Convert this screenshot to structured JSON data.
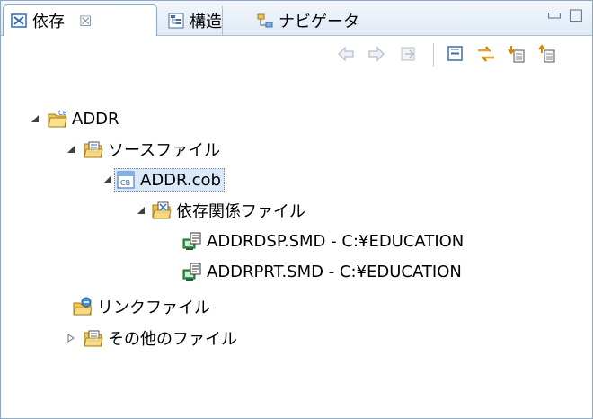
{
  "tabs": [
    {
      "label": "依存",
      "icon": "dependency-view-icon",
      "active": true,
      "close": "☒"
    },
    {
      "label": "構造",
      "icon": "structure-view-icon",
      "active": false
    },
    {
      "label": "ナビゲータ",
      "icon": "navigator-view-icon",
      "active": false
    }
  ],
  "window_controls": {
    "minimize": "▭",
    "maximize": "□"
  },
  "toolbar": [
    {
      "name": "back-icon",
      "enabled": false
    },
    {
      "name": "forward-icon",
      "enabled": false
    },
    {
      "name": "go-into-icon",
      "enabled": false
    },
    {
      "name": "collapse-all-icon",
      "enabled": true
    },
    {
      "name": "link-with-editor-icon",
      "enabled": true
    },
    {
      "name": "show-dependents-icon",
      "enabled": true
    },
    {
      "name": "show-dependencies-icon",
      "enabled": true
    }
  ],
  "tree": [
    {
      "label": "ADDR",
      "icon": "project-icon",
      "level": 0,
      "expanded": true
    },
    {
      "label": "ソースファイル",
      "icon": "source-folder-icon",
      "level": 1,
      "expanded": true
    },
    {
      "label": "ADDR.cob",
      "icon": "cobol-file-icon",
      "level": 2,
      "expanded": true,
      "selected": true
    },
    {
      "label": "依存関係ファイル",
      "icon": "dependency-folder-icon",
      "level": 3,
      "expanded": true
    },
    {
      "label": "ADDRDSP.SMD - C:¥EDUCATION",
      "icon": "screen-definition-icon",
      "level": 4
    },
    {
      "label": "ADDRPRT.SMD - C:¥EDUCATION",
      "icon": "screen-definition-icon",
      "level": 4
    },
    {
      "label": "リンクファイル",
      "icon": "link-file-icon",
      "level": 1
    },
    {
      "label": "その他のファイル",
      "icon": "other-files-folder-icon",
      "level": 1,
      "expanded": false
    }
  ],
  "colors": {
    "accent": "#2d6bb5",
    "selection_bg": "#dbe8f8",
    "folder": "#f3c653",
    "tab_border": "#8aa6c8"
  }
}
